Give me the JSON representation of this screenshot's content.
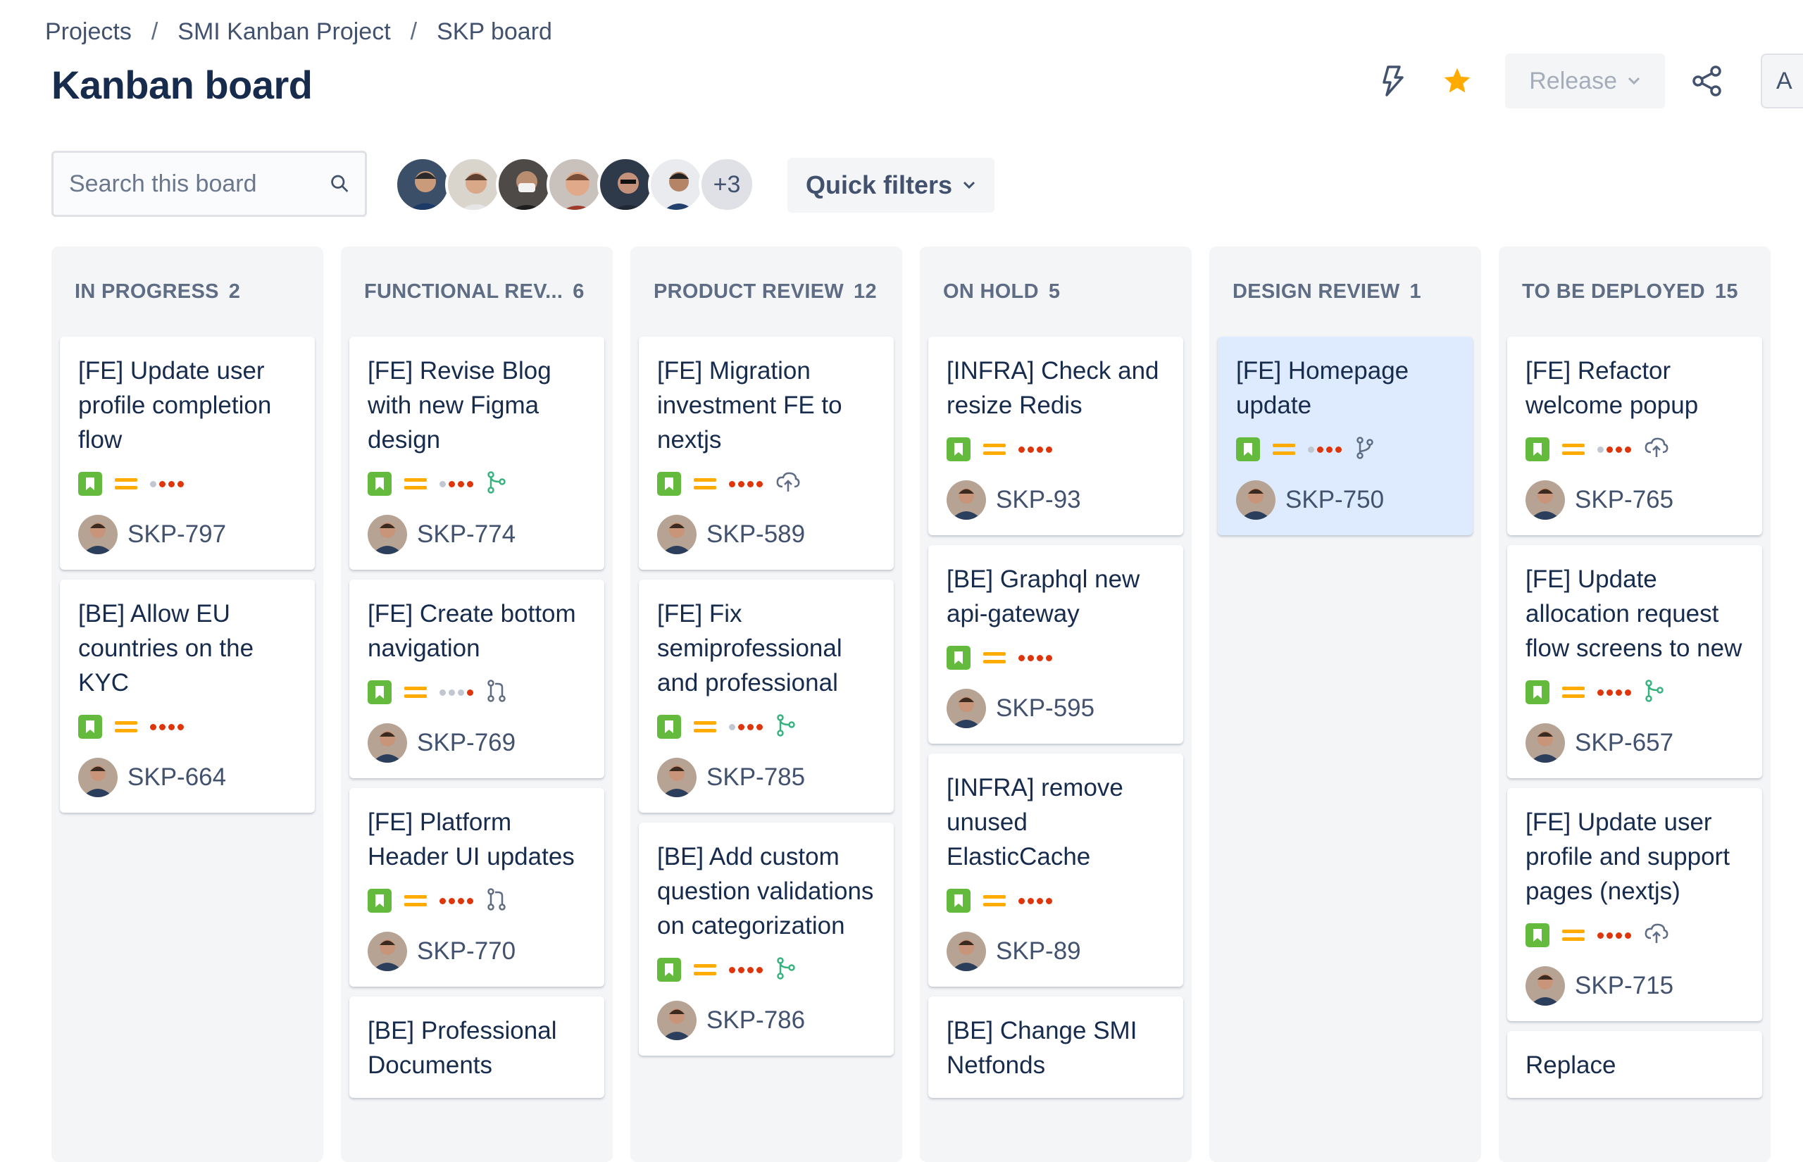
{
  "breadcrumb": {
    "projects": "Projects",
    "project": "SMI Kanban Project",
    "board": "SKP board",
    "sep": "/"
  },
  "page_title": "Kanban board",
  "toolbar": {
    "release_label": "Release",
    "a_label": "A"
  },
  "search": {
    "placeholder": "Search this board"
  },
  "avatars": {
    "more_label": "+3"
  },
  "quick_filters_label": "Quick filters",
  "colors": {
    "story": "#63ba3c",
    "priority": "#ffab00",
    "dot_red": "#de350b",
    "dot_grey": "#c1c7d0",
    "star": "#ffab00",
    "highlight": "#deebff"
  },
  "columns": [
    {
      "title": "IN PROGRESS",
      "count": "2",
      "cards": [
        {
          "title": "[FE] Update user profile completion flow",
          "key": "SKP-797",
          "dots": 3,
          "icon": ""
        },
        {
          "title": "[BE] Allow EU countries on the KYC",
          "key": "SKP-664",
          "dots": 4,
          "icon": ""
        }
      ]
    },
    {
      "title": "FUNCTIONAL REV...",
      "count": "6",
      "cards": [
        {
          "title": "[FE] Revise Blog with new Figma design",
          "key": "SKP-774",
          "dots": 3,
          "icon": "merged-icon"
        },
        {
          "title": "[FE] Create bottom navigation",
          "key": "SKP-769",
          "dots": 1,
          "icon": "pull-request-icon"
        },
        {
          "title": "[FE] Platform Header UI updates",
          "key": "SKP-770",
          "dots": 4,
          "icon": "pull-request-icon"
        },
        {
          "title": "[BE] Professional Documents",
          "key": "",
          "dots": 0,
          "icon": ""
        }
      ]
    },
    {
      "title": "PRODUCT REVIEW",
      "count": "12",
      "cards": [
        {
          "title": "[FE] Migration investment FE to nextjs",
          "key": "SKP-589",
          "dots": 4,
          "icon": "deploy-icon"
        },
        {
          "title": "[FE] Fix semiprofessional and professional",
          "key": "SKP-785",
          "dots": 3,
          "icon": "merged-icon"
        },
        {
          "title": "[BE] Add custom question validations on categorization",
          "key": "SKP-786",
          "dots": 4,
          "icon": "merged-icon"
        }
      ]
    },
    {
      "title": "ON HOLD",
      "count": "5",
      "cards": [
        {
          "title": "[INFRA] Check and resize Redis",
          "key": "SKP-93",
          "dots": 4,
          "icon": ""
        },
        {
          "title": "[BE] Graphql new api-gateway",
          "key": "SKP-595",
          "dots": 4,
          "icon": ""
        },
        {
          "title": "[INFRA] remove unused ElasticCache",
          "key": "SKP-89",
          "dots": 4,
          "icon": ""
        },
        {
          "title": "[BE] Change SMI Netfonds",
          "key": "",
          "dots": 0,
          "icon": ""
        }
      ]
    },
    {
      "title": "DESIGN REVIEW",
      "count": "1",
      "cards": [
        {
          "title": "[FE] Homepage update",
          "key": "SKP-750",
          "dots": 3,
          "icon": "branch-icon",
          "highlight": true
        }
      ]
    },
    {
      "title": "TO BE DEPLOYED",
      "count": "15",
      "cards": [
        {
          "title": "[FE] Refactor welcome popup",
          "key": "SKP-765",
          "dots": 3,
          "icon": "deploy-icon"
        },
        {
          "title": "[FE] Update allocation request flow screens to new",
          "key": "SKP-657",
          "dots": 4,
          "icon": "merged-icon"
        },
        {
          "title": "[FE] Update user profile and support pages (nextjs)",
          "key": "SKP-715",
          "dots": 4,
          "icon": "deploy-icon"
        },
        {
          "title": "Replace",
          "key": "",
          "dots": 0,
          "icon": ""
        }
      ]
    }
  ]
}
